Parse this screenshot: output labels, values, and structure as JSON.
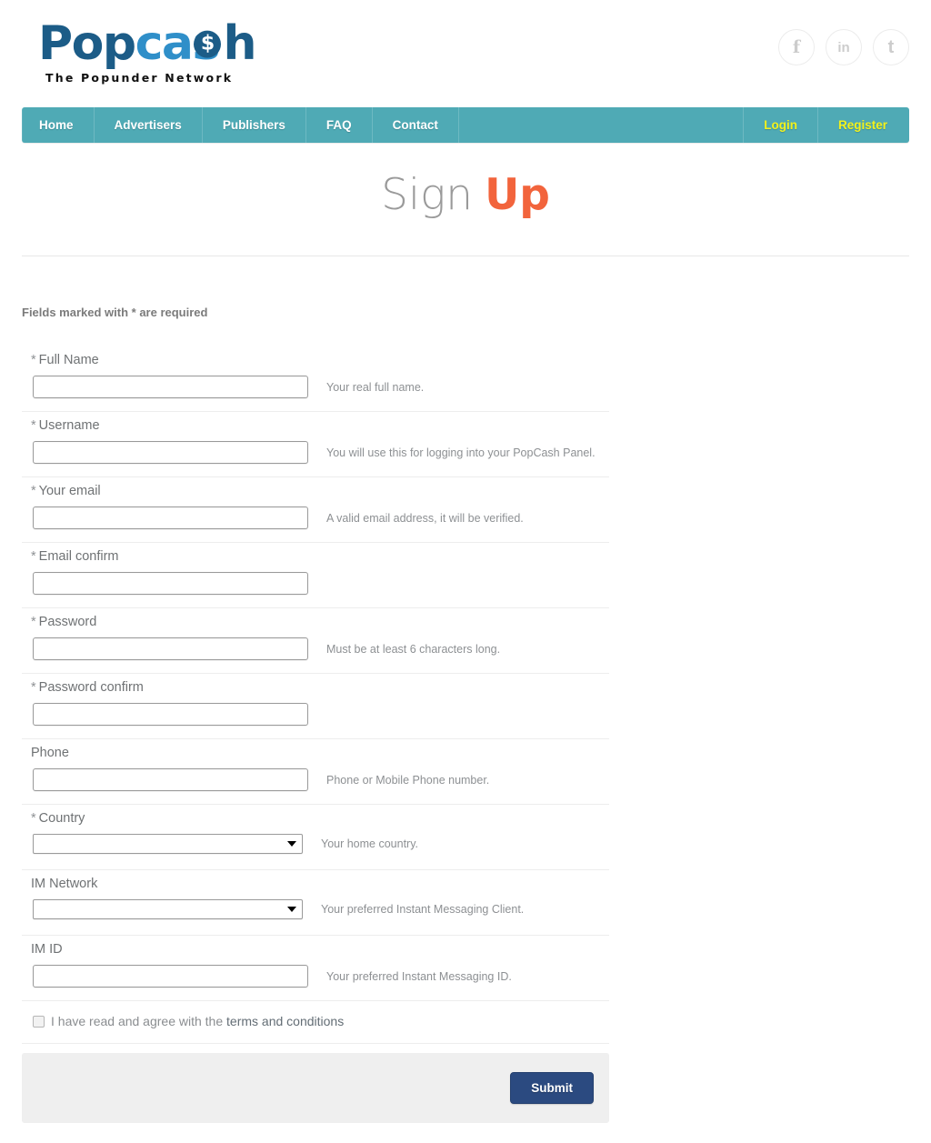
{
  "brand": {
    "logo_pop": "Pop",
    "logo_ca": "ca",
    "logo_s": "s",
    "logo_dollar": "$",
    "logo_h": "h",
    "tagline": "The Popunder Network",
    "colors": {
      "logo_dark": "#1c5c87",
      "logo_light": "#2f8fc9",
      "nav_teal": "#4faab5",
      "nav_accent_yellow": "#f2f21c",
      "title_accent_orange": "#f2643c",
      "submit_blue": "#2b4a80",
      "panel_gray": "#efefef"
    }
  },
  "socials": [
    {
      "name": "facebook-icon",
      "glyph": "f"
    },
    {
      "name": "linkedin-icon",
      "glyph": "in"
    },
    {
      "name": "twitter-icon",
      "glyph": "t"
    }
  ],
  "nav": {
    "left": [
      {
        "label": "Home"
      },
      {
        "label": "Advertisers"
      },
      {
        "label": "Publishers"
      },
      {
        "label": "FAQ"
      },
      {
        "label": "Contact"
      }
    ],
    "right": [
      {
        "label": "Login"
      },
      {
        "label": "Register"
      }
    ]
  },
  "page_title": {
    "light": "Sign",
    "accent": "Up"
  },
  "form": {
    "required_note": "Fields marked with * are required",
    "star": "*",
    "fields": [
      {
        "label": "Full Name",
        "required": true,
        "type": "text",
        "value": "",
        "placeholder": "",
        "help": "Your real full name."
      },
      {
        "label": "Username",
        "required": true,
        "type": "text",
        "value": "",
        "placeholder": "",
        "help": "You will use this for logging into your PopCash Panel."
      },
      {
        "label": "Your email",
        "required": true,
        "type": "text",
        "value": "",
        "placeholder": "",
        "help": "A valid email address, it will be verified."
      },
      {
        "label": "Email confirm",
        "required": true,
        "type": "text",
        "value": "",
        "placeholder": "",
        "help": ""
      },
      {
        "label": "Password",
        "required": true,
        "type": "password",
        "value": "",
        "placeholder": "",
        "help": "Must be at least 6 characters long."
      },
      {
        "label": "Password confirm",
        "required": true,
        "type": "password",
        "value": "",
        "placeholder": "",
        "help": ""
      },
      {
        "label": "Phone",
        "required": false,
        "type": "text",
        "value": "",
        "placeholder": "",
        "help": "Phone or Mobile Phone number."
      },
      {
        "label": "Country",
        "required": true,
        "type": "select",
        "value": "",
        "placeholder": "",
        "help": "Your home country."
      },
      {
        "label": "IM Network",
        "required": false,
        "type": "select",
        "value": "",
        "placeholder": "",
        "help": "Your preferred Instant Messaging Client."
      },
      {
        "label": "IM ID",
        "required": false,
        "type": "text",
        "value": "",
        "placeholder": "",
        "help": "Your preferred Instant Messaging ID."
      }
    ],
    "terms": {
      "checked": false,
      "text_before": "I have read and agree with the ",
      "link_text": "terms and conditions"
    },
    "submit_label": "Submit"
  }
}
